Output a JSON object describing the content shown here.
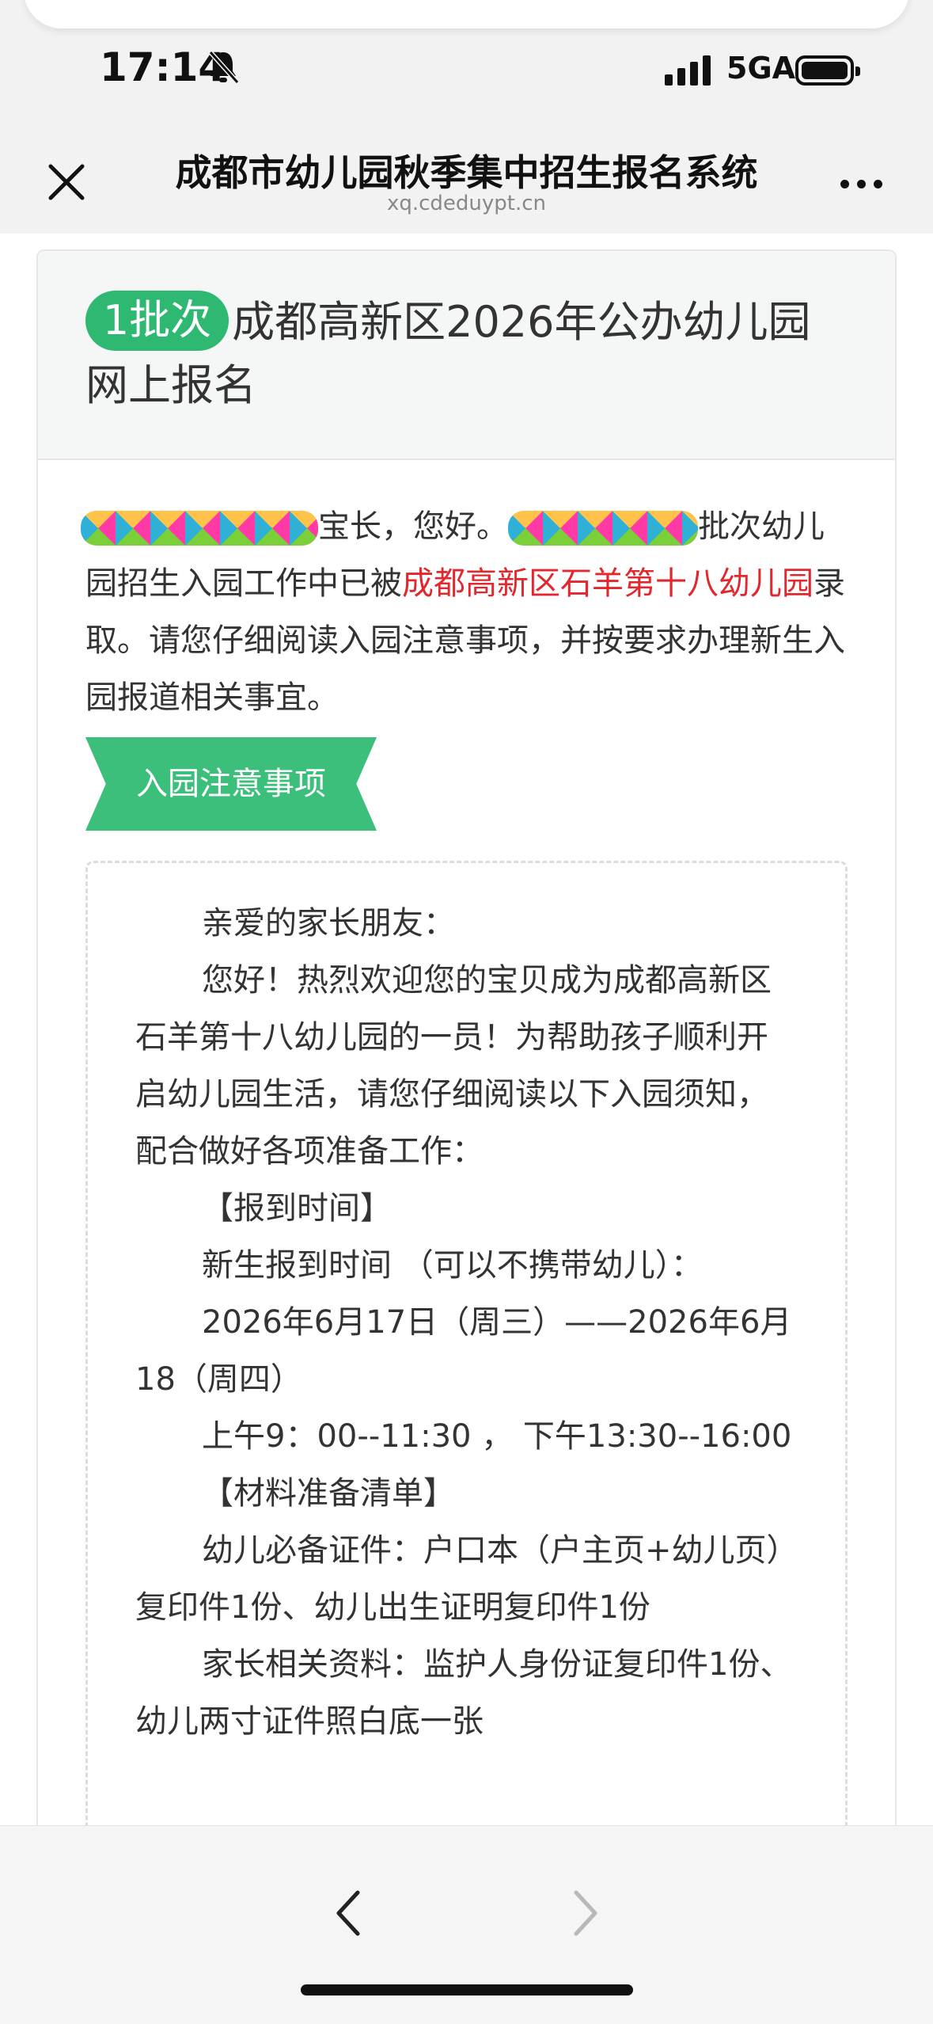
{
  "status_bar": {
    "time": "17:14",
    "network": "5GA",
    "icons": [
      "bell-muted-icon",
      "signal-icon",
      "battery-icon"
    ]
  },
  "nav": {
    "title": "成都市幼儿园秋季集中招生报名系统",
    "subtitle": "xq.cdeduypt.cn",
    "icons": [
      "close-icon",
      "more-icon"
    ]
  },
  "card": {
    "batch_badge": "1批次",
    "heading": "成都高新区2026年公办幼儿园网上报名",
    "intro": {
      "greeting_suffix": "宝长，您好。",
      "segment_before_school": "批次幼儿园招生入园工作中已被",
      "school_name": "成都高新区石羊第十八幼儿园",
      "segment_after_school": "录取。请您仔细阅读入园注意事项，并按要求办理新生入园报道相关事宜。"
    },
    "notice_banner": "入园注意事项",
    "notice_lines": [
      {
        "text": "亲爱的家长朋友：",
        "indent": true
      },
      {
        "text": "您好！热烈欢迎您的宝贝成为成都高新区石羊第十八幼儿园的一员！为帮助孩子顺利开启幼儿园生活，请您仔细阅读以下入园须知，配合做好各项准备工作：",
        "indent": true
      },
      {
        "text": "【报到时间】",
        "indent": true
      },
      {
        "text": "新生报到时间 （可以不携带幼儿）：",
        "indent": true
      },
      {
        "text": "2026年6月17日（周三）——2026年6月18（周四）",
        "indent": true
      },
      {
        "text": "上午9：00--11:30 ， 下午13:30--16:00",
        "indent": true
      },
      {
        "text": "【材料准备清单】",
        "indent": true
      },
      {
        "text": "幼儿必备证件：户口本（户主页+幼儿页）复印件1份、幼儿出生证明复印件1份",
        "indent": true
      },
      {
        "text": "家长相关资料：监护人身份证复印件1份、幼儿两寸证件照白底一张",
        "indent": true
      }
    ]
  },
  "toolbar": {
    "icons": [
      "chevron-left-icon",
      "chevron-right-icon"
    ]
  },
  "colors": {
    "accent_green": "#2fb871",
    "highlight_red": "#e0282e"
  }
}
